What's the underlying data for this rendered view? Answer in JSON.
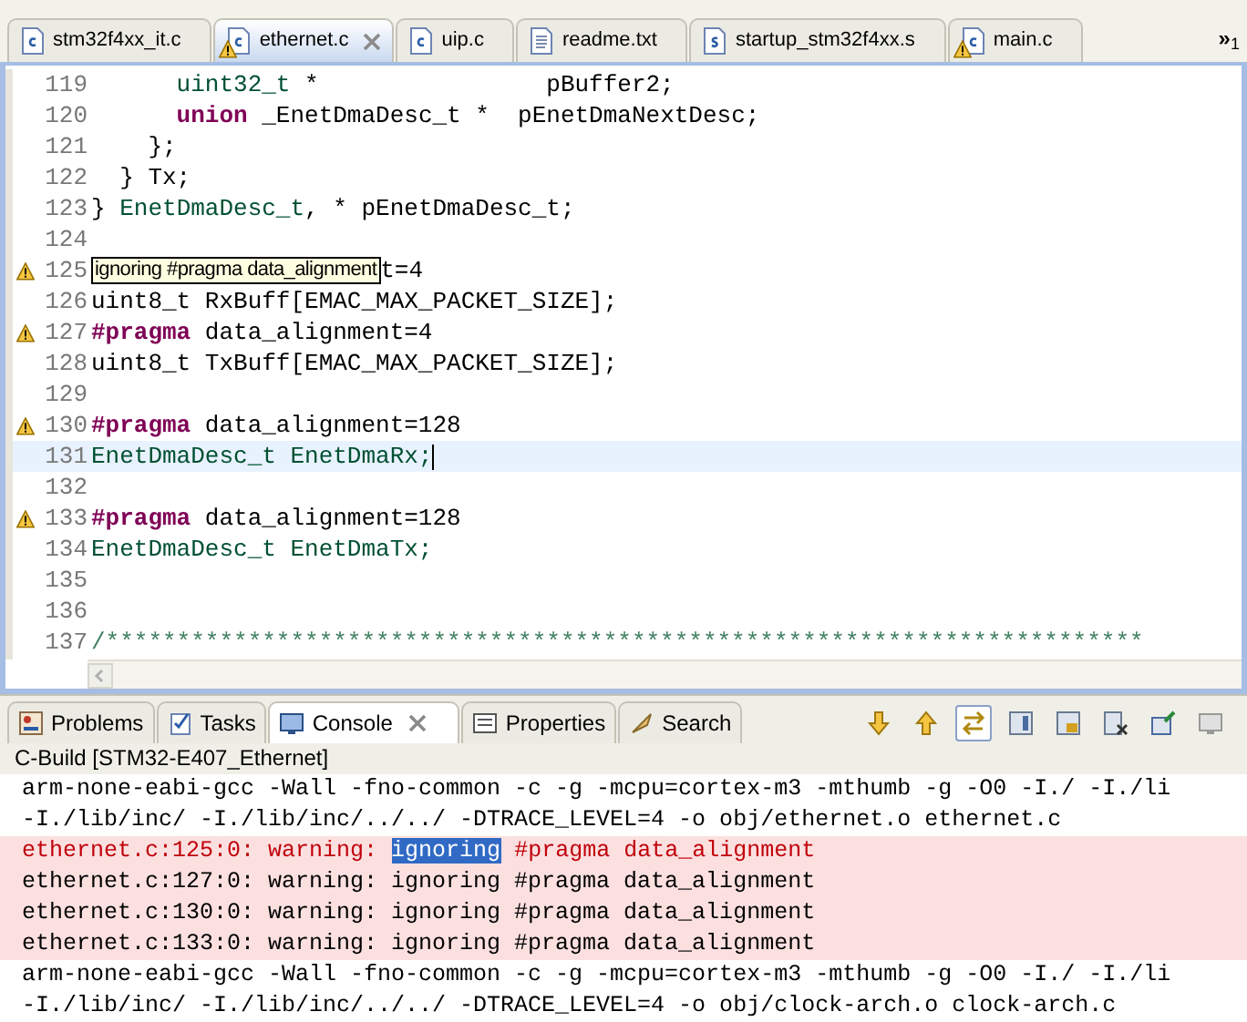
{
  "editor_tabs": [
    {
      "label": "stm32f4xx_it.c",
      "kind": "c",
      "warning": false,
      "selected": false,
      "closable": false
    },
    {
      "label": "ethernet.c",
      "kind": "c",
      "warning": true,
      "selected": true,
      "closable": true
    },
    {
      "label": "uip.c",
      "kind": "c",
      "warning": false,
      "selected": false,
      "closable": false
    },
    {
      "label": "readme.txt",
      "kind": "text",
      "warning": false,
      "selected": false,
      "closable": false
    },
    {
      "label": "startup_stm32f4xx.s",
      "kind": "s",
      "warning": false,
      "selected": false,
      "closable": false
    },
    {
      "label": "main.c",
      "kind": "c",
      "warning": true,
      "selected": false,
      "closable": false
    }
  ],
  "tab_overflow": {
    "symbol": "»",
    "count": "1"
  },
  "code_lines": [
    {
      "number": "119",
      "warning": false,
      "current": false,
      "segments": [
        {
          "text": "      uint32_t",
          "kind": "type"
        },
        {
          "text": " *                pBuffer2;",
          "kind": "plain"
        }
      ]
    },
    {
      "number": "120",
      "warning": false,
      "current": false,
      "segments": [
        {
          "text": "      union",
          "kind": "keyword"
        },
        {
          "text": " _EnetDmaDesc_t *  pEnetDmaNextDesc;",
          "kind": "plain"
        }
      ]
    },
    {
      "number": "121",
      "warning": false,
      "current": false,
      "segments": [
        {
          "text": "    };",
          "kind": "plain"
        }
      ]
    },
    {
      "number": "122",
      "warning": false,
      "current": false,
      "segments": [
        {
          "text": "  } Tx;",
          "kind": "plain"
        }
      ]
    },
    {
      "number": "123",
      "warning": false,
      "current": false,
      "segments": [
        {
          "text": "} ",
          "kind": "plain"
        },
        {
          "text": "EnetDmaDesc_t",
          "kind": "type"
        },
        {
          "text": ", * pEnetDmaDesc_t;",
          "kind": "plain"
        }
      ]
    },
    {
      "number": "124",
      "warning": false,
      "current": false
    },
    {
      "number": "125",
      "warning": true,
      "current": false,
      "tooltip": "ignoring #pragma data_alignment",
      "segments": [
        {
          "text": "t=4",
          "kind": "plain"
        }
      ]
    },
    {
      "number": "126",
      "warning": false,
      "current": false,
      "segments": [
        {
          "text": "uint8_t RxBuff[EMAC_MAX_PACKET_SIZE];",
          "kind": "plain"
        }
      ]
    },
    {
      "number": "127",
      "warning": true,
      "current": false,
      "segments": [
        {
          "text": "#pragma",
          "kind": "keyword"
        },
        {
          "text": " data_alignment=4",
          "kind": "plain"
        }
      ]
    },
    {
      "number": "128",
      "warning": false,
      "current": false,
      "segments": [
        {
          "text": "uint8_t TxBuff[EMAC_MAX_PACKET_SIZE];",
          "kind": "plain"
        }
      ]
    },
    {
      "number": "129",
      "warning": false,
      "current": false
    },
    {
      "number": "130",
      "warning": true,
      "current": false,
      "segments": [
        {
          "text": "#pragma",
          "kind": "keyword"
        },
        {
          "text": " data_alignment=128",
          "kind": "plain"
        }
      ]
    },
    {
      "number": "131",
      "warning": false,
      "current": true,
      "segments": [
        {
          "text": "EnetDmaDesc_t EnetDmaRx;",
          "kind": "type"
        }
      ]
    },
    {
      "number": "132",
      "warning": false,
      "current": false
    },
    {
      "number": "133",
      "warning": true,
      "current": false,
      "segments": [
        {
          "text": "#pragma",
          "kind": "keyword"
        },
        {
          "text": " data_alignment=128",
          "kind": "plain"
        }
      ]
    },
    {
      "number": "134",
      "warning": false,
      "current": false,
      "segments": [
        {
          "text": "EnetDmaDesc_t EnetDmaTx;",
          "kind": "type"
        }
      ]
    },
    {
      "number": "135",
      "warning": false,
      "current": false
    },
    {
      "number": "136",
      "warning": false,
      "current": false
    },
    {
      "number": "137",
      "warning": false,
      "current": false,
      "segments": [
        {
          "text": "/*************************************************************************",
          "kind": "comment"
        }
      ]
    }
  ],
  "panel_tabs": [
    {
      "label": "Problems",
      "kind": "problems",
      "selected": false,
      "closable": false
    },
    {
      "label": "Tasks",
      "kind": "tasks",
      "selected": false,
      "closable": false
    },
    {
      "label": "Console",
      "kind": "console",
      "selected": true,
      "closable": true
    },
    {
      "label": "Properties",
      "kind": "properties",
      "selected": false,
      "closable": false
    },
    {
      "label": "Search",
      "kind": "search",
      "selected": false,
      "closable": false
    }
  ],
  "console": {
    "title": "C-Build [STM32-E407_Ethernet]",
    "lines": [
      {
        "kind": "output",
        "parts": [
          {
            "text": "arm-none-eabi-gcc -Wall -fno-common -c -g -mcpu=cortex-m3 -mthumb -g -O0 -I./ -I./li",
            "selected": false
          }
        ]
      },
      {
        "kind": "output",
        "parts": [
          {
            "text": "-I./lib/inc/ -I./lib/inc/../../ -DTRACE_LEVEL=4 -o obj/ethernet.o ethernet.c",
            "selected": false
          }
        ]
      },
      {
        "kind": "error",
        "parts": [
          {
            "text": "ethernet.c:125:0: warning: ",
            "selected": false
          },
          {
            "text": "ignoring",
            "selected": true
          },
          {
            "text": " #pragma data_alignment",
            "selected": false
          }
        ]
      },
      {
        "kind": "warning",
        "parts": [
          {
            "text": "ethernet.c:127:0: warning: ignoring #pragma data_alignment",
            "selected": false
          }
        ]
      },
      {
        "kind": "warning",
        "parts": [
          {
            "text": "ethernet.c:130:0: warning: ignoring #pragma data_alignment",
            "selected": false
          }
        ]
      },
      {
        "kind": "warning",
        "parts": [
          {
            "text": "ethernet.c:133:0: warning: ignoring #pragma data_alignment",
            "selected": false
          }
        ]
      },
      {
        "kind": "output",
        "parts": [
          {
            "text": "arm-none-eabi-gcc -Wall -fno-common -c -g -mcpu=cortex-m3 -mthumb -g -O0 -I./ -I./li",
            "selected": false
          }
        ]
      },
      {
        "kind": "output",
        "parts": [
          {
            "text": "-I./lib/inc/ -I./lib/inc/../../ -DTRACE_LEVEL=4 -o obj/clock-arch.o clock-arch.c",
            "selected": false
          }
        ]
      }
    ]
  },
  "console_toolbar": [
    {
      "kind": "down",
      "pressed": false
    },
    {
      "kind": "up",
      "pressed": false
    },
    {
      "kind": "swap",
      "pressed": true
    },
    {
      "kind": "grid",
      "pressed": false
    },
    {
      "kind": "lock",
      "pressed": false
    },
    {
      "kind": "remove",
      "pressed": false
    },
    {
      "kind": "pin",
      "pressed": false
    },
    {
      "kind": "monitor",
      "pressed": false
    }
  ]
}
